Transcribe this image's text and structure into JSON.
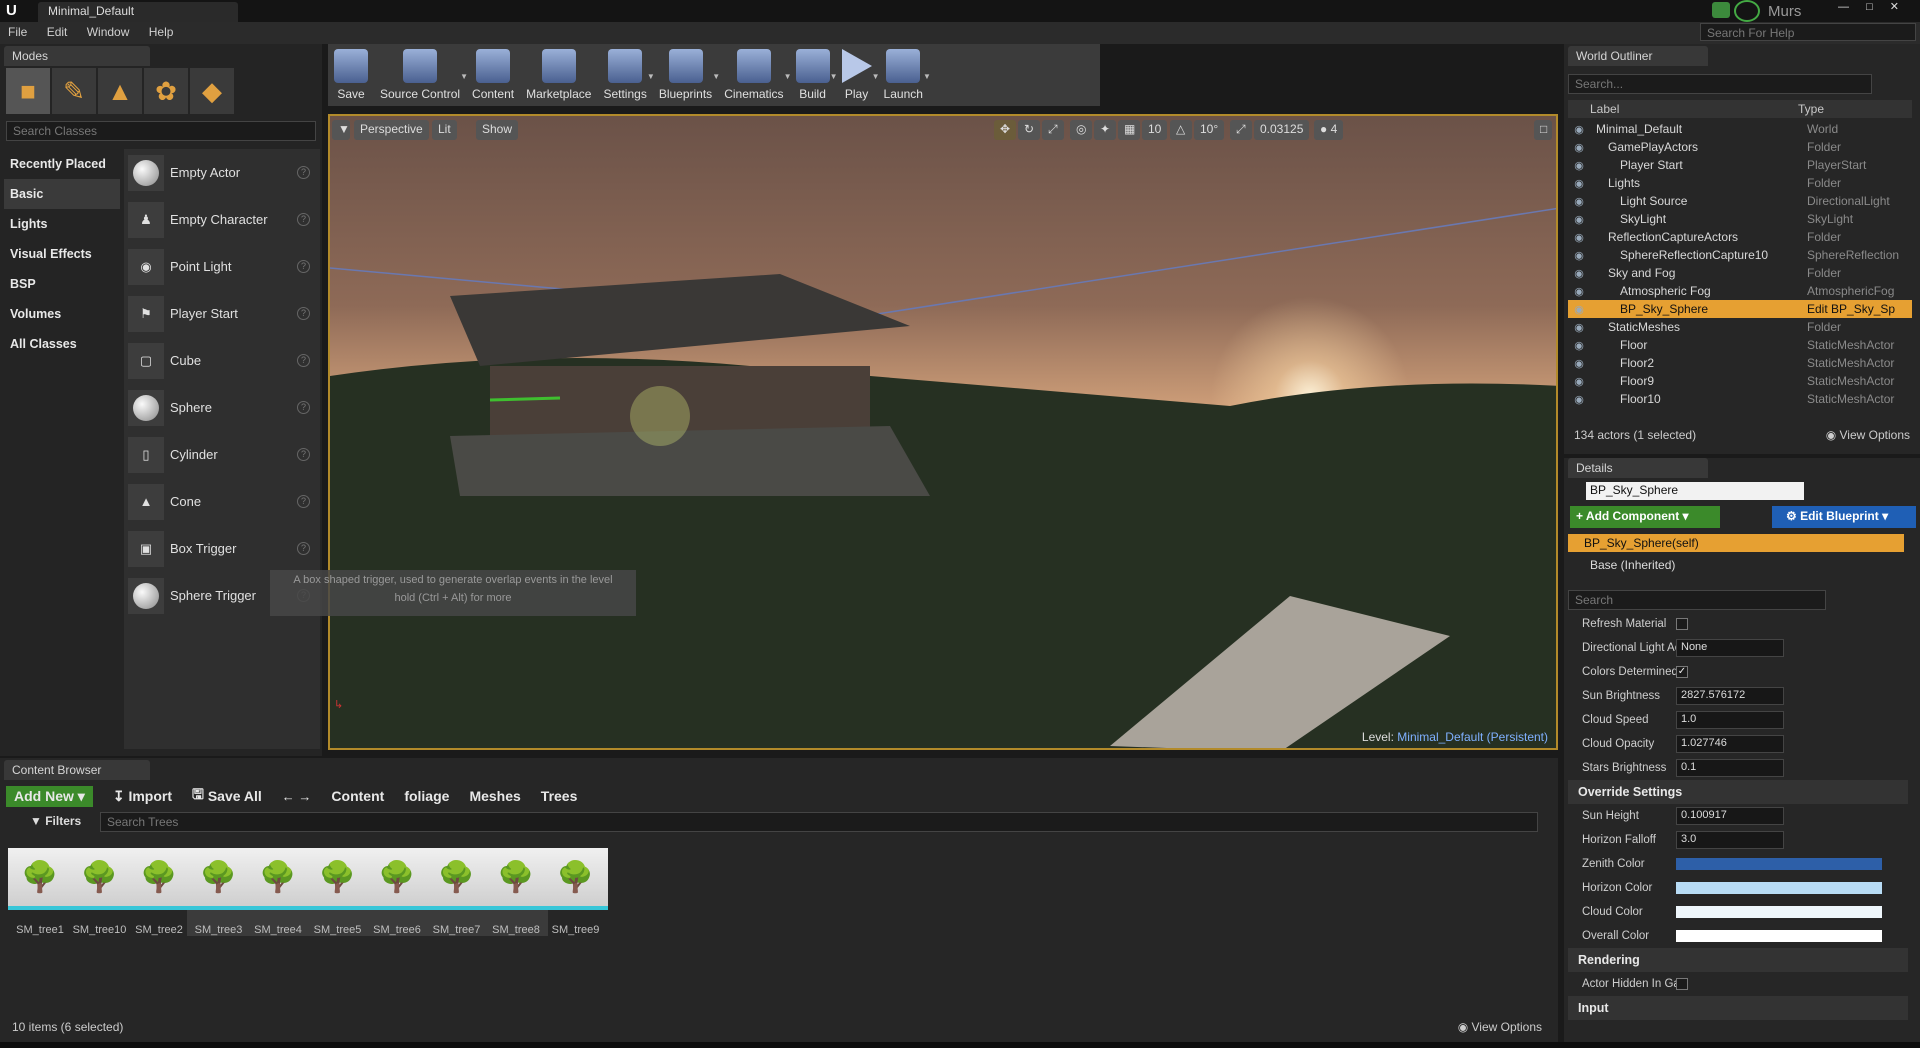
{
  "app": {
    "tab_title": "Minimal_Default",
    "user": "Murs",
    "help_search_placeholder": "Search For Help"
  },
  "menu": [
    "File",
    "Edit",
    "Window",
    "Help"
  ],
  "modes": {
    "tab": "Modes",
    "search_placeholder": "Search Classes",
    "categories": [
      "Recently Placed",
      "Basic",
      "Lights",
      "Visual Effects",
      "BSP",
      "Volumes",
      "All Classes"
    ],
    "selected_category": "Basic",
    "items": [
      "Empty Actor",
      "Empty Character",
      "Point Light",
      "Player Start",
      "Cube",
      "Sphere",
      "Cylinder",
      "Cone",
      "Box Trigger",
      "Sphere Trigger"
    ],
    "tooltip_line1": "A box shaped trigger, used to generate overlap events in the level",
    "tooltip_line2": "hold (Ctrl + Alt) for more"
  },
  "toolbar": {
    "buttons": [
      "Save",
      "Source Control",
      "Content",
      "Marketplace",
      "Settings",
      "Blueprints",
      "Cinematics",
      "Build",
      "Play",
      "Launch"
    ]
  },
  "viewport": {
    "perspective": "Perspective",
    "lit": "Lit",
    "show": "Show",
    "grid_snap": "10",
    "rot_snap": "10°",
    "scale_snap": "0.03125",
    "cam_speed": "4",
    "level_label": "Level:",
    "level_name": "Minimal_Default (Persistent)"
  },
  "outliner": {
    "tab": "World Outliner",
    "search_placeholder": "Search...",
    "col_label": "Label",
    "col_type": "Type",
    "rows": [
      {
        "label": "Minimal_Default",
        "type": "World",
        "indent": 0
      },
      {
        "label": "GamePlayActors",
        "type": "Folder",
        "indent": 1
      },
      {
        "label": "Player Start",
        "type": "PlayerStart",
        "indent": 2
      },
      {
        "label": "Lights",
        "type": "Folder",
        "indent": 1
      },
      {
        "label": "Light Source",
        "type": "DirectionalLight",
        "indent": 2
      },
      {
        "label": "SkyLight",
        "type": "SkyLight",
        "indent": 2
      },
      {
        "label": "ReflectionCaptureActors",
        "type": "Folder",
        "indent": 1
      },
      {
        "label": "SphereReflectionCapture10",
        "type": "SphereReflection",
        "indent": 2
      },
      {
        "label": "Sky and Fog",
        "type": "Folder",
        "indent": 1
      },
      {
        "label": "Atmospheric Fog",
        "type": "AtmosphericFog",
        "indent": 2
      },
      {
        "label": "BP_Sky_Sphere",
        "type": "Edit BP_Sky_Sp",
        "indent": 2,
        "selected": true
      },
      {
        "label": "StaticMeshes",
        "type": "Folder",
        "indent": 1
      },
      {
        "label": "Floor",
        "type": "StaticMeshActor",
        "indent": 2
      },
      {
        "label": "Floor2",
        "type": "StaticMeshActor",
        "indent": 2
      },
      {
        "label": "Floor9",
        "type": "StaticMeshActor",
        "indent": 2
      },
      {
        "label": "Floor10",
        "type": "StaticMeshActor",
        "indent": 2
      }
    ],
    "status": "134 actors (1 selected)",
    "view_options": "View Options"
  },
  "details": {
    "tab": "Details",
    "name": "BP_Sky_Sphere",
    "add_component": "+ Add Component",
    "edit_blueprint": "Edit Blueprint",
    "self_row": "BP_Sky_Sphere(self)",
    "base_row": "Base (Inherited)",
    "search_placeholder": "Search",
    "props": [
      {
        "name": "Refresh Material",
        "kind": "check",
        "value": ""
      },
      {
        "name": "Directional Light Act",
        "kind": "combo",
        "value": "None"
      },
      {
        "name": "Colors Determined E",
        "kind": "check",
        "value": "checked"
      },
      {
        "name": "Sun Brightness",
        "kind": "num",
        "value": "2827.576172"
      },
      {
        "name": "Cloud Speed",
        "kind": "num",
        "value": "1.0"
      },
      {
        "name": "Cloud Opacity",
        "kind": "num",
        "value": "1.027746"
      },
      {
        "name": "Stars Brightness",
        "kind": "num",
        "value": "0.1"
      }
    ],
    "override_title": "Override Settings",
    "override_props": [
      {
        "name": "Sun Height",
        "kind": "num",
        "value": "0.100917"
      },
      {
        "name": "Horizon Falloff",
        "kind": "num",
        "value": "3.0"
      },
      {
        "name": "Zenith Color",
        "kind": "color",
        "value": "#2d5fa8"
      },
      {
        "name": "Horizon Color",
        "kind": "color",
        "value": "#b8dcf5"
      },
      {
        "name": "Cloud Color",
        "kind": "color",
        "value": "#eef6fb"
      },
      {
        "name": "Overall Color",
        "kind": "color",
        "value": "#ffffff"
      }
    ],
    "rendering_title": "Rendering",
    "rendering_prop": "Actor Hidden In Gam",
    "input_title": "Input"
  },
  "content_browser": {
    "tab": "Content Browser",
    "add_new": "Add New",
    "import": "Import",
    "save_all": "Save All",
    "path": [
      "Content",
      "foliage",
      "Meshes",
      "Trees"
    ],
    "filters": "Filters",
    "search_placeholder": "Search Trees",
    "assets": [
      "SM_tree1",
      "SM_tree10",
      "SM_tree2",
      "SM_tree3",
      "SM_tree4",
      "SM_tree5",
      "SM_tree6",
      "SM_tree7",
      "SM_tree8",
      "SM_tree9"
    ],
    "selected_count": 6,
    "status": "10 items (6 selected)",
    "view_options": "View Options"
  }
}
